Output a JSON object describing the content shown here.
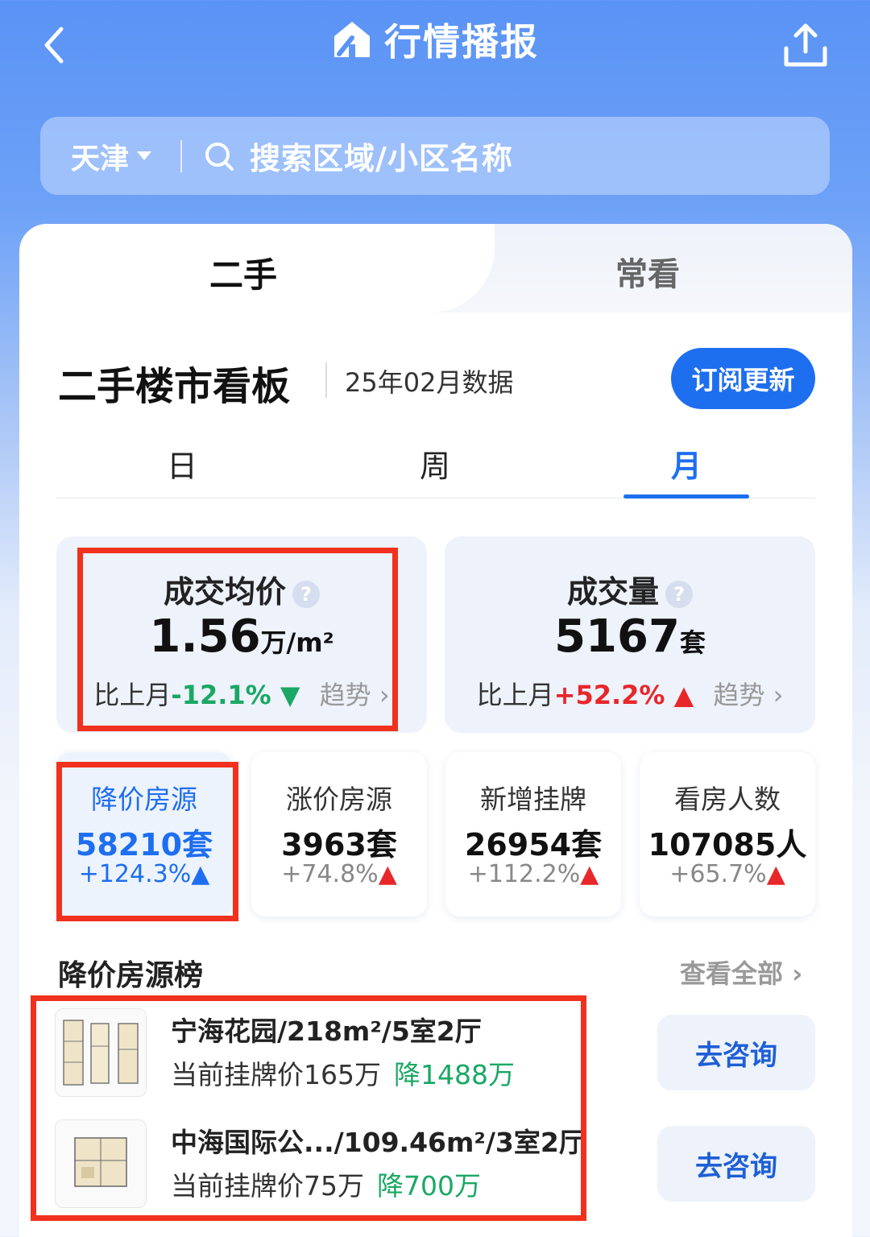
{
  "header": {
    "title": "行情播报"
  },
  "search": {
    "city": "天津",
    "placeholder": "搜索区域/小区名称"
  },
  "tabs": {
    "main": "二手",
    "other": "常看"
  },
  "board": {
    "title": "二手楼市看板",
    "date": "25年02月数据",
    "subscribe_label": "订阅更新"
  },
  "periods": [
    "日",
    "周",
    "月"
  ],
  "stats": [
    {
      "title": "成交均价",
      "value": "1.56",
      "unit": "万/m²",
      "prefix": "比上月",
      "change": "-12.1%",
      "trend_label": "趋势"
    },
    {
      "title": "成交量",
      "value": "5167",
      "unit": "套",
      "prefix": "比上月",
      "change": "+52.2%",
      "trend_label": "趋势"
    }
  ],
  "mini_stats": [
    {
      "title": "降价房源",
      "value": "58210套",
      "change": "+124.3%"
    },
    {
      "title": "涨价房源",
      "value": "3963套",
      "change": "+74.8%"
    },
    {
      "title": "新增挂牌",
      "value": "26954套",
      "change": "+112.2%"
    },
    {
      "title": "看房人数",
      "value": "107085人",
      "change": "+65.7%"
    }
  ],
  "ranking": {
    "title": "降价房源榜",
    "view_all": "查看全部",
    "items": [
      {
        "name": "宁海花园/218m²/5室2厅",
        "price": "当前挂牌价165万",
        "drop": "降1488万",
        "action": "去咨询"
      },
      {
        "name": "中海国际公.../109.46m²/3室2厅",
        "price": "当前挂牌价75万",
        "drop": "降700万",
        "action": "去咨询"
      }
    ]
  },
  "colors": {
    "accent": "#1e6ef0",
    "down": "#1aa864",
    "up": "#e8272b",
    "annotation": "#f0311e"
  }
}
